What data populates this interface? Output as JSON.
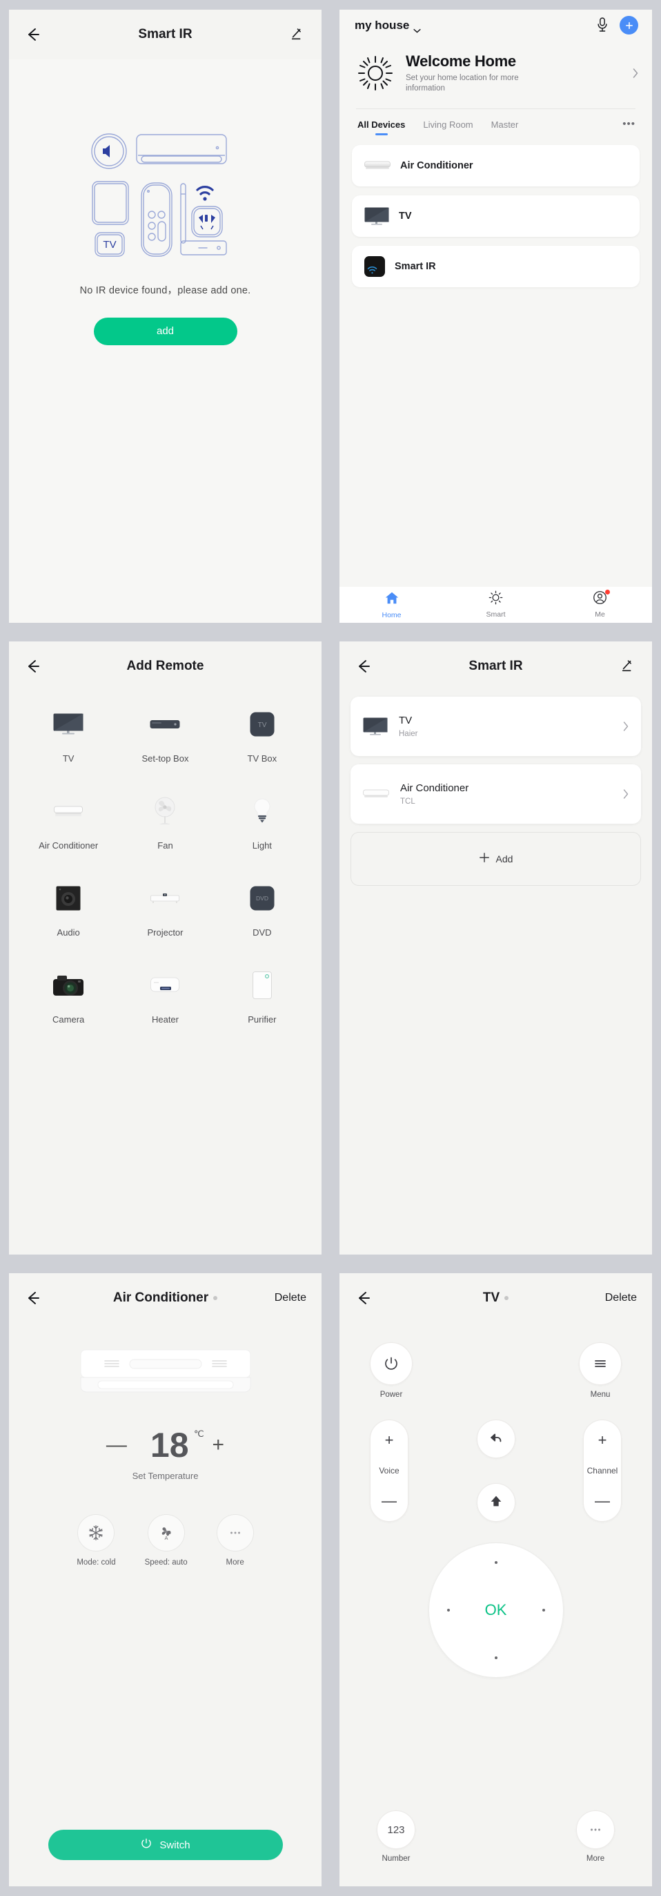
{
  "panel1": {
    "nav": {
      "title": "Smart IR",
      "back_icon": "back-arrow-icon",
      "edit_icon": "pencil-icon"
    },
    "empty_message": "No IR device found，please add one.",
    "add_button": "add"
  },
  "panel2": {
    "house_name": "my house",
    "mic_icon": "microphone-icon",
    "add_icon": "plus-icon",
    "welcome_title": "Welcome Home",
    "welcome_subtitle": "Set your home location for more information",
    "weather_icon": "sun-icon",
    "tabs": [
      {
        "label": "All Devices",
        "active": true
      },
      {
        "label": "Living Room",
        "active": false
      },
      {
        "label": "Master",
        "active": false
      }
    ],
    "tabs_more": "•••",
    "devices": [
      {
        "name": "Air Conditioner",
        "icon": "air-conditioner-icon"
      },
      {
        "name": "TV",
        "icon": "tv-icon"
      },
      {
        "name": "Smart IR",
        "icon": "smart-ir-icon"
      }
    ],
    "tabbar": [
      {
        "label": "Home",
        "icon": "home-icon",
        "active": true,
        "badge": false
      },
      {
        "label": "Smart",
        "icon": "sun-icon",
        "active": false,
        "badge": false
      },
      {
        "label": "Me",
        "icon": "person-icon",
        "active": false,
        "badge": true
      }
    ]
  },
  "panel3": {
    "nav": {
      "title": "Add Remote",
      "back_icon": "back-arrow-icon"
    },
    "items": [
      {
        "label": "TV",
        "icon": "tv-icon"
      },
      {
        "label": "Set-top Box",
        "icon": "set-top-box-icon"
      },
      {
        "label": "TV Box",
        "icon": "tv-box-icon"
      },
      {
        "label": "Air Conditioner",
        "icon": "air-conditioner-icon"
      },
      {
        "label": "Fan",
        "icon": "fan-icon"
      },
      {
        "label": "Light",
        "icon": "light-bulb-icon"
      },
      {
        "label": "Audio",
        "icon": "speaker-icon"
      },
      {
        "label": "Projector",
        "icon": "projector-icon"
      },
      {
        "label": "DVD",
        "icon": "dvd-icon"
      },
      {
        "label": "Camera",
        "icon": "camera-icon"
      },
      {
        "label": "Heater",
        "icon": "heater-icon"
      },
      {
        "label": "Purifier",
        "icon": "purifier-icon"
      }
    ]
  },
  "panel4": {
    "nav": {
      "title": "Smart IR",
      "back_icon": "back-arrow-icon",
      "edit_icon": "pencil-icon"
    },
    "remotes": [
      {
        "name": "TV",
        "brand": "Haier",
        "icon": "tv-icon"
      },
      {
        "name": "Air Conditioner",
        "brand": "TCL",
        "icon": "air-conditioner-icon"
      }
    ],
    "add_label": "Add"
  },
  "panel5": {
    "nav": {
      "title": "Air Conditioner",
      "back_icon": "back-arrow-icon",
      "delete_label": "Delete"
    },
    "temperature": "18",
    "temperature_unit": "℃",
    "minus": "—",
    "plus": "+",
    "caption": "Set Temperature",
    "controls": [
      {
        "label": "Mode: cold",
        "icon": "snowflake-icon"
      },
      {
        "label": "Speed: auto",
        "icon": "fan-auto-icon"
      },
      {
        "label": "More",
        "icon": "ellipsis-icon"
      }
    ],
    "switch_label": "Switch",
    "switch_icon": "power-icon"
  },
  "panel6": {
    "nav": {
      "title": "TV",
      "back_icon": "back-arrow-icon",
      "delete_label": "Delete"
    },
    "power": {
      "label": "Power",
      "icon": "power-icon"
    },
    "menu": {
      "label": "Menu",
      "icon": "hamburger-icon"
    },
    "voice": {
      "label": "Voice",
      "plus": "+",
      "minus": "—"
    },
    "channel": {
      "label": "Channel",
      "plus": "+",
      "minus": "—"
    },
    "back_btn": {
      "icon": "reply-arrow-icon"
    },
    "home_btn": {
      "icon": "up-arrow-icon"
    },
    "dpad": {
      "ok_label": "OK"
    },
    "number": {
      "label": "Number",
      "value": "123"
    },
    "more": {
      "label": "More",
      "icon": "ellipsis-icon"
    }
  },
  "colors": {
    "accent_green": "#03c88a",
    "accent_blue": "#4a8df7",
    "ok_green": "#0ac286",
    "page_bg": "#ced0d6"
  }
}
